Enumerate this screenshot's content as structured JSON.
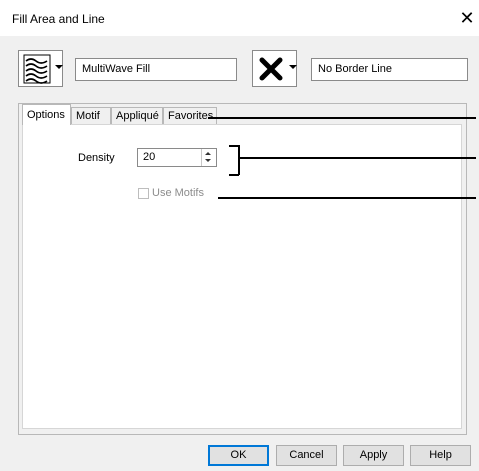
{
  "window": {
    "title": "Fill Area and Line"
  },
  "fill": {
    "name": "MultiWave Fill",
    "icon": "multiwave-fill-icon"
  },
  "border": {
    "name": "No Border Line",
    "icon": "no-border-x-icon"
  },
  "tabs": [
    {
      "label": "Options",
      "active": true
    },
    {
      "label": "Motif",
      "active": false
    },
    {
      "label": "Appliqué",
      "active": false
    },
    {
      "label": "Favorites",
      "active": false
    }
  ],
  "options": {
    "density_label": "Density",
    "density_value": "20",
    "use_motifs_label": "Use Motifs",
    "use_motifs_checked": false,
    "use_motifs_enabled": false
  },
  "buttons": {
    "ok": "OK",
    "cancel": "Cancel",
    "apply": "Apply",
    "help": "Help"
  },
  "colors": {
    "accent": "#0078d7",
    "dialog_bg": "#f0f0f0"
  }
}
